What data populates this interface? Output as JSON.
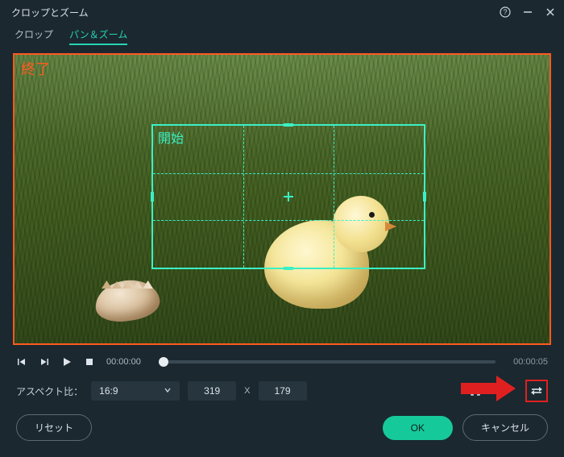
{
  "window": {
    "title": "クロップとズーム"
  },
  "tabs": {
    "crop": "クロップ",
    "panzoom": "パン＆ズーム"
  },
  "preview": {
    "end_label": "終了",
    "start_label": "開始"
  },
  "transport": {
    "current_time": "00:00:00",
    "total_time": "00:00:05"
  },
  "aspect": {
    "label": "アスペクト比：",
    "ratio_selected": "16:9",
    "width": "319",
    "height": "179",
    "x_separator": "X"
  },
  "icons": {
    "help": "help-icon",
    "minimize": "minimize-icon",
    "close": "close-icon",
    "prev_frame": "prev-frame-icon",
    "next_frame": "next-frame-icon",
    "play": "play-icon",
    "stop": "stop-icon",
    "chevron_down": "chevron-down-icon",
    "fit_center": "fit-center-icon",
    "swap": "swap-icon"
  },
  "footer": {
    "reset": "リセット",
    "ok": "OK",
    "cancel": "キャンセル"
  }
}
